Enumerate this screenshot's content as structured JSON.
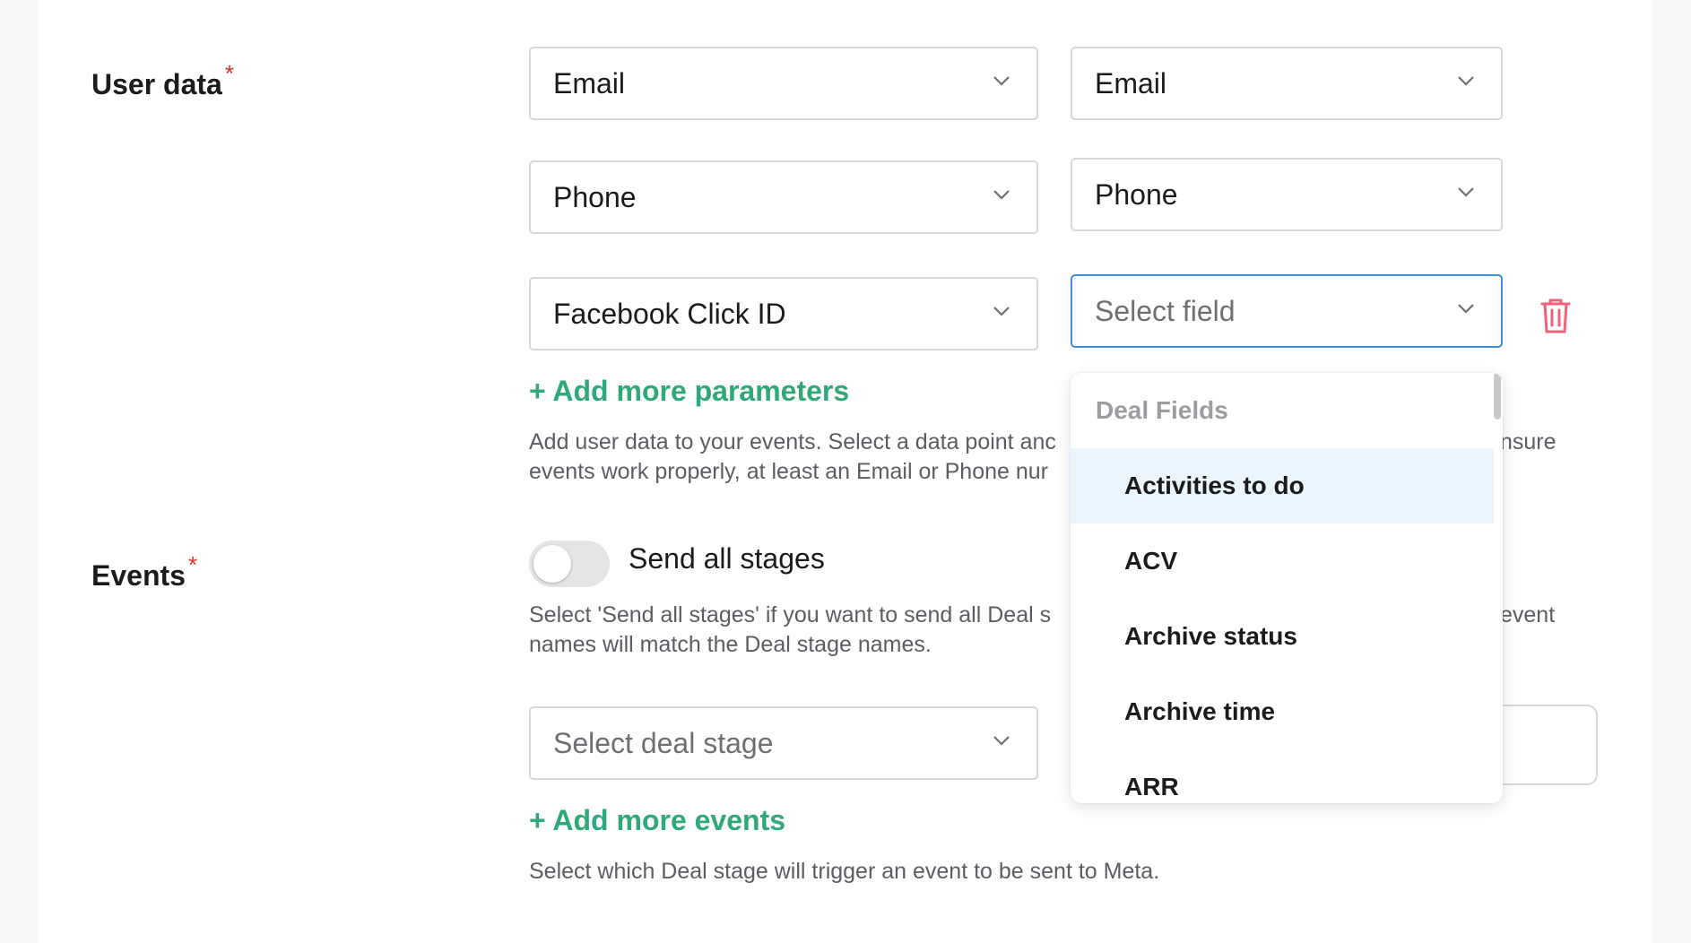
{
  "user_data": {
    "label": "User data",
    "required_mark": "*",
    "rows": [
      {
        "source": "Email",
        "target": "Email"
      },
      {
        "source": "Phone",
        "target": "Phone"
      },
      {
        "source": "Facebook Click ID",
        "target_placeholder": "Select field"
      }
    ],
    "add_more": "+ Add more parameters",
    "help_line1": "Add user data to your events. Select a data point anc",
    "help_line1_tail": "nsure",
    "help_line2": "events work properly, at least an Email or Phone nur"
  },
  "events": {
    "label": "Events",
    "required_mark": "*",
    "toggle_label": "Send all stages",
    "toggle_on": false,
    "help_line1": "Select 'Send all stages' if you want to send all Deal s",
    "help_line1_tail": "event",
    "help_line2": "names will match the Deal stage names.",
    "stage_placeholder": "Select deal stage",
    "add_more": "+ Add more events",
    "help_bottom": "Select which Deal stage will trigger an event to be sent to Meta."
  },
  "dropdown": {
    "group_label": "Deal Fields",
    "options": [
      "Activities to do",
      "ACV",
      "Archive status",
      "Archive time",
      "ARR"
    ],
    "highlighted_index": 0
  },
  "icons": {
    "chevron": "chevron-down-icon",
    "trash": "trash-icon"
  },
  "colors": {
    "accent_green": "#2fa87a",
    "required_red": "#e0302e",
    "focus_blue": "#3b8ee0",
    "trash_red": "#f0607a",
    "highlight_bg": "#eaf5fd"
  }
}
